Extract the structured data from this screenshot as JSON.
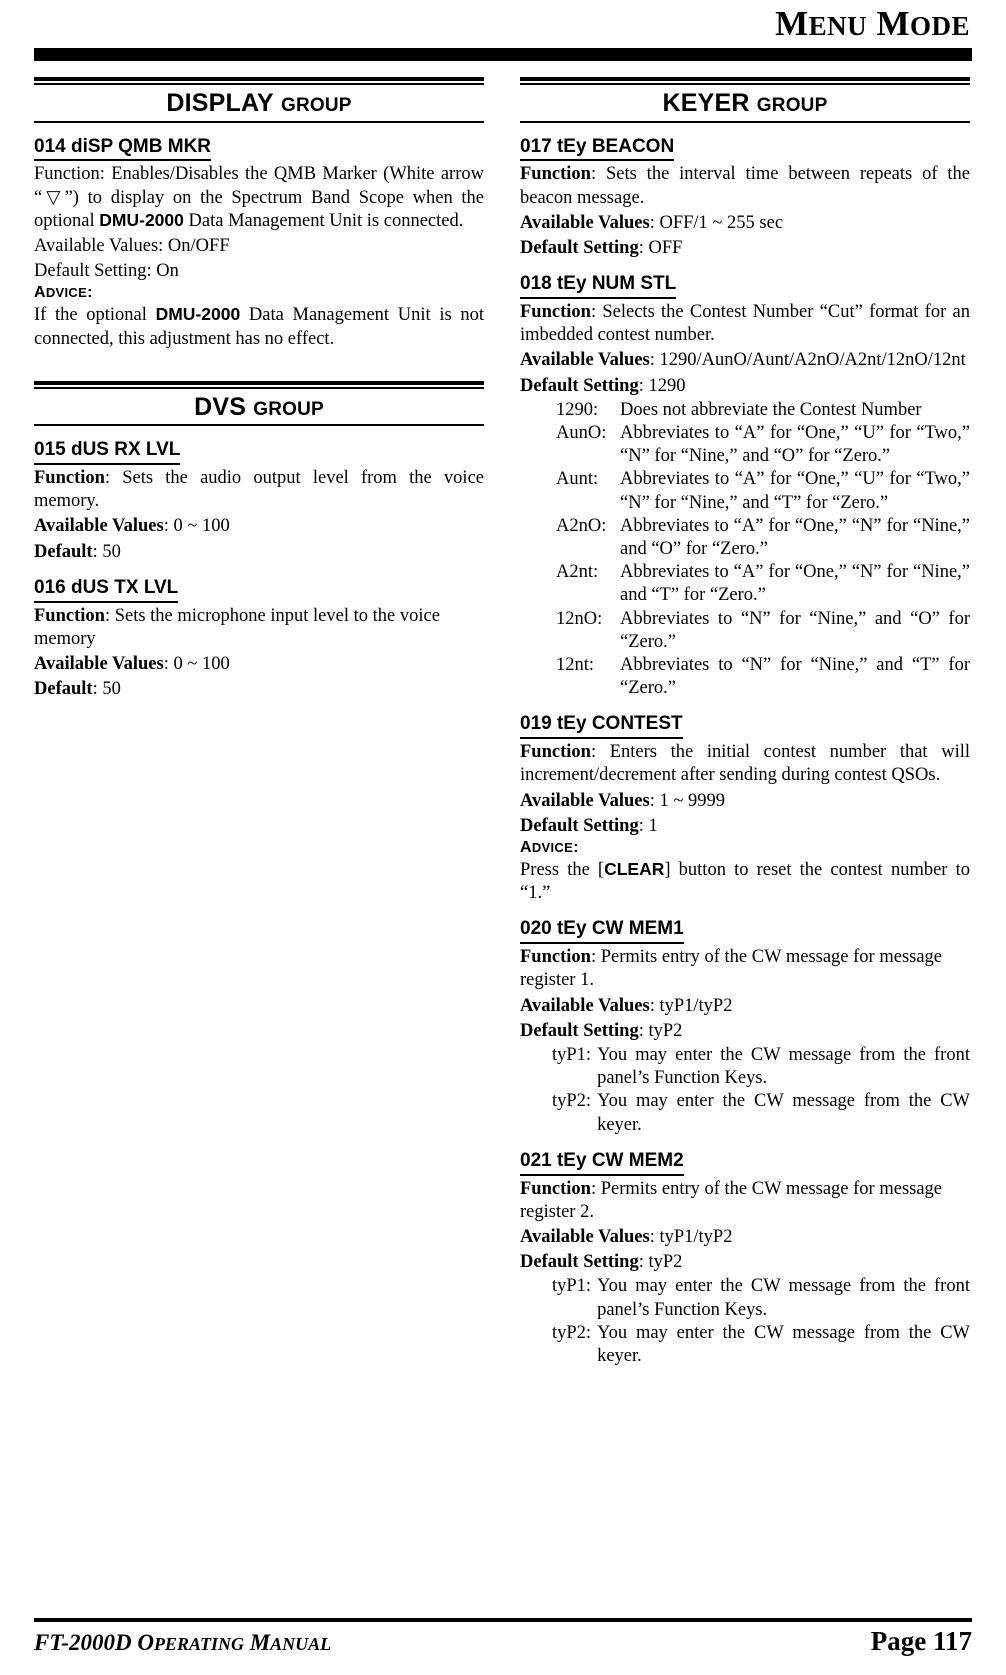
{
  "header": {
    "title_main": "M",
    "title_rest1": "ENU",
    "title_main2": "M",
    "title_rest2": "ODE"
  },
  "left_column": {
    "group": {
      "big": "DISPLAY",
      "small": "GROUP"
    },
    "entries": [
      {
        "title": "014 diSP QMB MKR",
        "lines": [
          "Function: Enables/Disables the QMB Marker (White arrow “▽”) to display on the Spectrum Band Scope when the optional DMU-2000 Data Management Unit is connected.",
          "Available Values: On/OFF",
          "Default Setting: On"
        ],
        "advice_label": "ADVICE:",
        "advice_text": "If the optional DMU-2000 Data Management Unit is not connected, this adjustment has no effect."
      }
    ],
    "group2": {
      "big": "DVS",
      "small": "GROUP"
    },
    "entries2": [
      {
        "title": "015 dUS RX LVL",
        "function_label": "Function",
        "function_text": ": Sets the audio output level from the voice memory.",
        "values_label": "Available Values",
        "values_text": ": 0 ~ 100",
        "default_label": "Default",
        "default_text": ": 50"
      },
      {
        "title": "016 dUS TX LVL",
        "function_label": "Function",
        "function_text": ": Sets the microphone input level to the voice memory",
        "values_label": "Available Values",
        "values_text": ": 0 ~ 100",
        "default_label": "Default",
        "default_text": ": 50"
      }
    ]
  },
  "right_column": {
    "group": {
      "big": "KEYER",
      "small": "GROUP"
    },
    "entries": [
      {
        "title": "017 tEy BEACON",
        "function_label": "Function",
        "function_text": ": Sets the interval time between repeats of the beacon message.",
        "values_label": "Available Values",
        "values_text": ": OFF/1 ~ 255 sec",
        "default_label": "Default Setting",
        "default_text": ": OFF"
      },
      {
        "title": "018 tEy NUM STL",
        "function_label": "Function",
        "function_text": ": Selects the Contest Number “Cut” format for an imbedded contest number.",
        "values_label": "Available Values",
        "values_text": ": 1290/AunO/Aunt/A2nO/A2nt/12nO/12nt",
        "default_label": "Default Setting",
        "default_text": ": 1290",
        "deflist": [
          {
            "term": "1290:",
            "desc": "Does not abbreviate the Contest Number"
          },
          {
            "term": "AunO:",
            "desc": "Abbreviates to “A” for “One,” “U” for “Two,” “N” for “Nine,” and “O” for “Zero.”"
          },
          {
            "term": "Aunt:",
            "desc": "Abbreviates to “A” for “One,” “U” for “Two,” “N” for “Nine,” and “T” for “Zero.”"
          },
          {
            "term": "A2nO:",
            "desc": "Abbreviates to “A” for “One,” “N” for “Nine,” and “O” for “Zero.”"
          },
          {
            "term": "A2nt:",
            "desc": "Abbreviates to “A” for “One,” “N” for “Nine,” and “T” for “Zero.”"
          },
          {
            "term": "12nO:",
            "desc": "Abbreviates to “N” for “Nine,” and “O” for “Zero.”"
          },
          {
            "term": "12nt:",
            "desc": "Abbreviates to “N” for “Nine,” and “T” for “Zero.”"
          }
        ]
      },
      {
        "title": "019 tEy CONTEST",
        "function_label": "Function",
        "function_text": ": Enters the initial contest number that will increment/decrement after sending during contest QSOs.",
        "values_label": "Available Values",
        "values_text": ": 1 ~ 9999",
        "default_label": "Default Setting",
        "default_text": ": 1",
        "advice_label": "ADVICE:",
        "advice_pre": "Press the [",
        "advice_key": "CLEAR",
        "advice_post": "] button to reset the contest number to “1.”"
      },
      {
        "title": "020 tEy CW MEM1",
        "function_label": "Function",
        "function_text": ": Permits entry of the CW message for message register 1.",
        "values_label": "Available Values",
        "values_text": ": tyP1/tyP2",
        "default_label": "Default Setting",
        "default_text": ": tyP2",
        "deflist": [
          {
            "term": "tyP1:",
            "desc": "You may enter the CW message from the front panel’s Function Keys."
          },
          {
            "term": "tyP2:",
            "desc": "You may enter the CW message from the CW keyer."
          }
        ]
      },
      {
        "title": "021 tEy CW MEM2",
        "function_label": "Function",
        "function_text": ": Permits entry of the CW message for message register 2.",
        "values_label": "Available Values",
        "values_text": ": tyP1/tyP2",
        "default_label": "Default Setting",
        "default_text": ": tyP2",
        "deflist": [
          {
            "term": "tyP1:",
            "desc": "You may enter the CW message from the front panel’s Function Keys."
          },
          {
            "term": "tyP2:",
            "desc": "You may enter the CW message from the CW keyer."
          }
        ]
      }
    ]
  },
  "footer": {
    "left_big1": "FT-2000D",
    "left_small1": "OPERATING",
    "left_small2": "MANUAL",
    "right": "Page 117"
  }
}
